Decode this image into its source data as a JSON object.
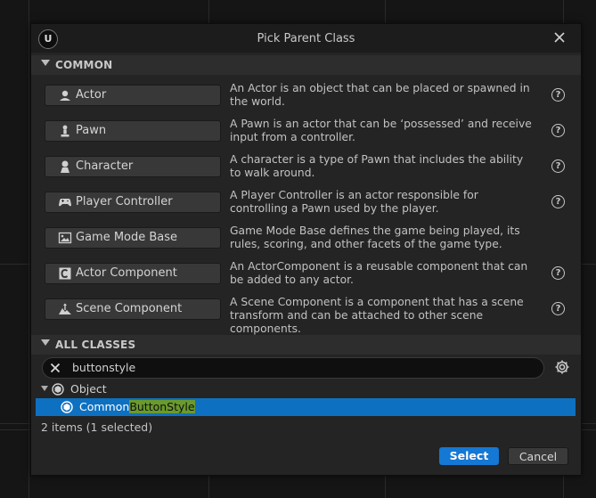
{
  "dialog": {
    "title": "Pick Parent Class",
    "logo_text": "U"
  },
  "common": {
    "header": "COMMON",
    "items": [
      {
        "label": "Actor",
        "icon": "actor-icon",
        "description": "An Actor is an object that can be placed or spawned in the world.",
        "help": "?"
      },
      {
        "label": "Pawn",
        "icon": "pawn-icon",
        "description": "A Pawn is an actor that can be ‘possessed’ and receive input from a controller.",
        "help": "?"
      },
      {
        "label": "Character",
        "icon": "character-icon",
        "description": "A character is a type of Pawn that includes the ability to walk around.",
        "help": "?"
      },
      {
        "label": "Player Controller",
        "icon": "gamepad-icon",
        "description": "A Player Controller is an actor responsible for controlling a Pawn used by the player.",
        "help": "?"
      },
      {
        "label": "Game Mode Base",
        "icon": "game-mode-icon",
        "description": "Game Mode Base defines the game being played, its rules, scoring, and other facets of the game type.",
        "help": ""
      },
      {
        "label": "Actor Component",
        "icon": "actor-component-icon",
        "description": "An ActorComponent is a reusable component that can be added to any actor.",
        "help": "?"
      },
      {
        "label": "Scene Component",
        "icon": "scene-component-icon",
        "description": "A Scene Component is a component that has a scene transform and can be attached to other scene components.",
        "help": "?"
      }
    ]
  },
  "all_classes": {
    "header": "ALL CLASSES",
    "search_value": "buttonstyle",
    "tree": [
      {
        "label": "Object",
        "icon": "object-icon"
      },
      {
        "label_prefix": "Common",
        "label_match": "ButtonStyle",
        "icon": "object-icon",
        "selected": true
      }
    ],
    "status": "2 items (1 selected)"
  },
  "footer": {
    "select_label": "Select",
    "cancel_label": "Cancel"
  },
  "colors": {
    "accent": "#1478d4",
    "selection": "#0e70c0",
    "highlight": "#6a9a2e"
  }
}
